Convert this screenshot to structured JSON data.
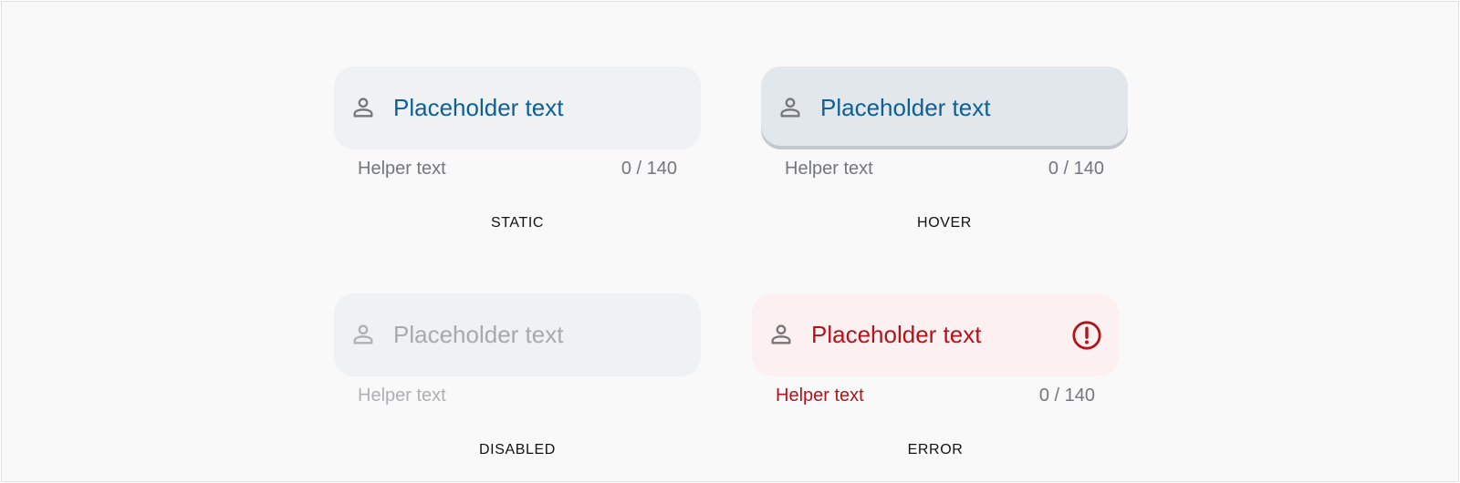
{
  "colors": {
    "frame_background": "#f9f9f9",
    "field_background": "#f0f1f3",
    "hover_field_background": "#e2e7eb",
    "error_field_background": "#fdf0f1",
    "placeholder_blue": "#0e5f96",
    "error_red": "#b1141c",
    "helper_gray": "#75767a",
    "disabled_gray": "#a8a9ab"
  },
  "icons": {
    "leading": "person-icon",
    "error_trailing": "alert-circle-icon"
  },
  "variants": {
    "static": {
      "placeholder": "Placeholder text",
      "helper": "Helper text",
      "counter": "0 / 140",
      "label": "STATIC"
    },
    "hover": {
      "placeholder": "Placeholder text",
      "helper": "Helper text",
      "counter": "0 / 140",
      "label": "HOVER"
    },
    "disabled": {
      "placeholder": "Placeholder text",
      "helper": "Helper text",
      "label": "DISABLED"
    },
    "error": {
      "placeholder": "Placeholder text",
      "helper": "Helper text",
      "counter": "0 / 140",
      "label": "ERROR"
    }
  }
}
